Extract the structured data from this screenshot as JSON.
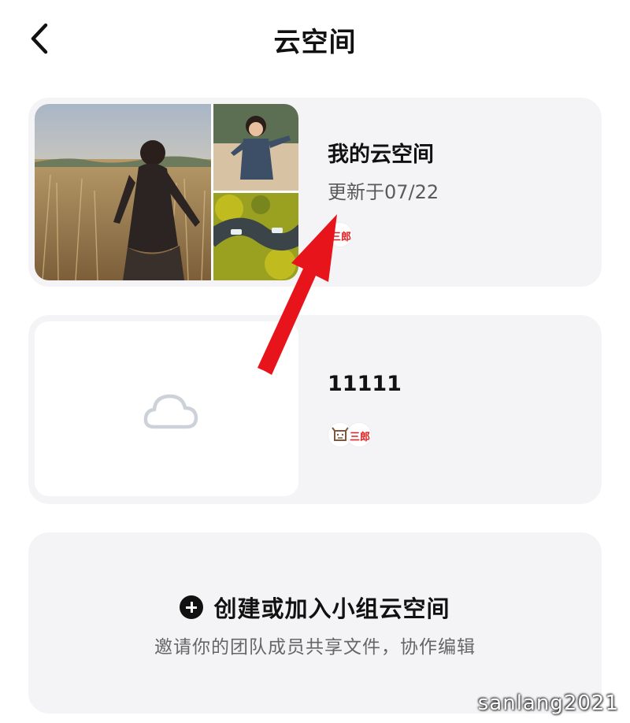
{
  "header": {
    "title": "云空间",
    "back_icon": "chevron-left-icon"
  },
  "spaces": [
    {
      "name": "我的云空间",
      "updated": "更新于07/22",
      "avatars": [
        {
          "label": "三郎"
        }
      ]
    },
    {
      "name": "11111",
      "thumbnail_icon": "cloud-icon",
      "avatars": [
        {
          "label": "logo"
        },
        {
          "label": "三郎"
        }
      ]
    }
  ],
  "create": {
    "icon": "plus-circle-icon",
    "label": "创建或加入小组云空间",
    "description": "邀请你的团队成员共享文件，协作编辑"
  },
  "annotation": {
    "color": "#e8141b"
  },
  "watermark": "sanlang2021"
}
